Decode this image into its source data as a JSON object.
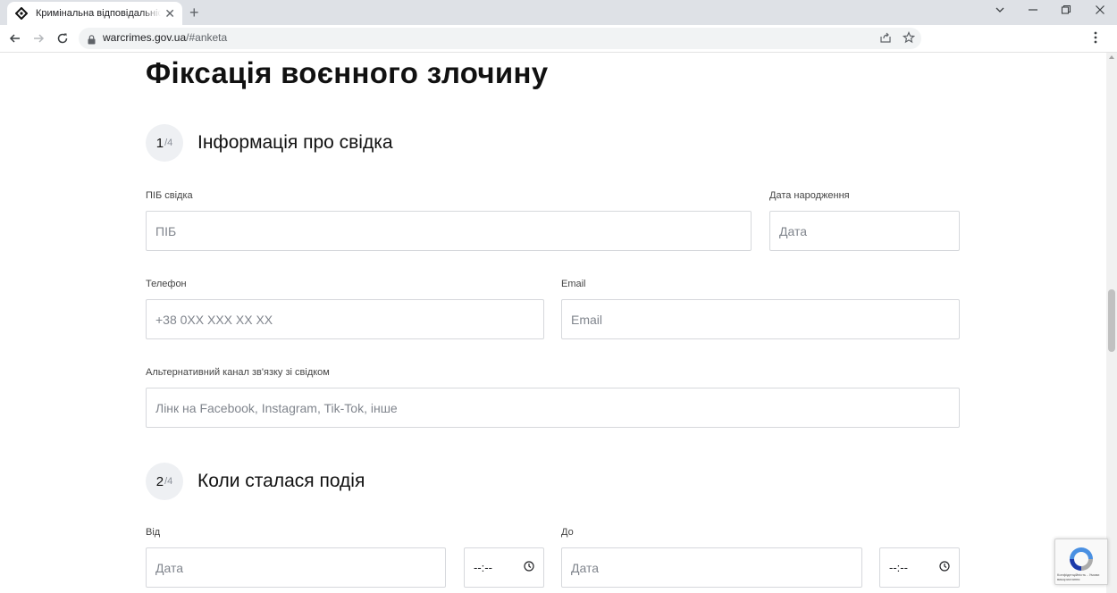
{
  "browser": {
    "tab_title": "Кримінальна відповідальність з",
    "tab_close": "✕",
    "new_tab": "+",
    "url_host": "warcrimes.gov.ua",
    "url_path": "/#anketa"
  },
  "page": {
    "title": "Фіксація воєнного злочину",
    "step1": {
      "number": "1",
      "total": "/4",
      "title": "Інформація про свідка",
      "name_label": "ПІБ свідка",
      "name_placeholder": "ПІБ",
      "birth_label": "Дата народження",
      "birth_placeholder": "Дата",
      "phone_label": "Телефон",
      "phone_placeholder": "+38 0XX XXX XX XX",
      "email_label": "Email",
      "email_placeholder": "Email",
      "alt_label": "Альтернативний канал зв'язку зі свідком",
      "alt_placeholder": "Лінк на Facebook, Instagram, Tik-Tok, інше"
    },
    "step2": {
      "number": "2",
      "total": "/4",
      "title": "Коли сталася подія",
      "from_label": "Від",
      "from_date_placeholder": "Дата",
      "from_time": "--:--",
      "to_label": "До",
      "to_date_placeholder": "Дата",
      "to_time": "--:--"
    }
  },
  "recaptcha": {
    "footer": "Конфіденційність - Умови використання"
  }
}
